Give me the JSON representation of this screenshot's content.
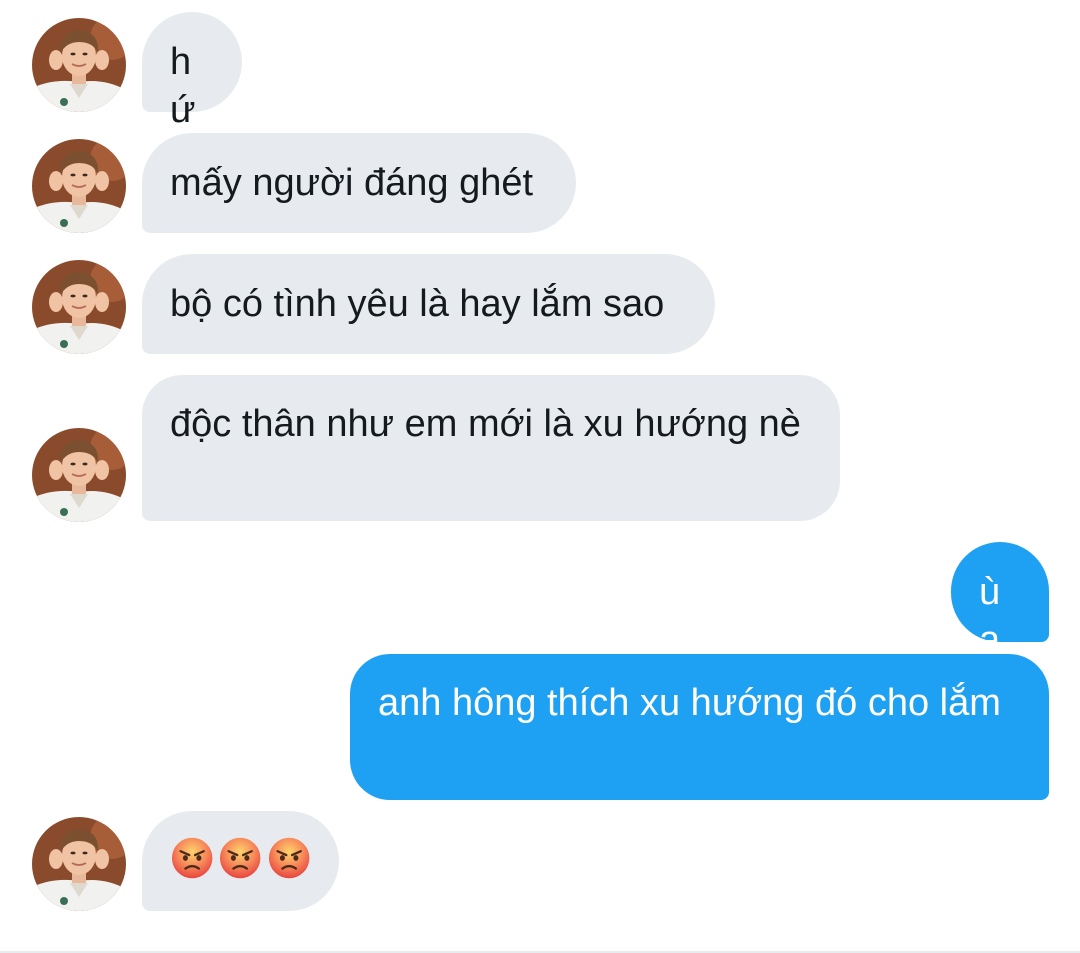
{
  "messages": [
    {
      "sender": "them",
      "text": "hứ"
    },
    {
      "sender": "them",
      "text": "mấy người đáng ghét"
    },
    {
      "sender": "them",
      "text": "bộ có tình yêu là hay lắm sao"
    },
    {
      "sender": "them",
      "text": "độc thân như em mới là xu hướng nè"
    },
    {
      "sender": "me",
      "text": "ùa"
    },
    {
      "sender": "me",
      "text": "anh hông thích xu hướng đó cho lắm"
    },
    {
      "sender": "them",
      "emojis": [
        "angry-face-icon",
        "angry-face-icon",
        "angry-face-icon"
      ]
    }
  ],
  "colors": {
    "incoming_bubble": "#e7ebef",
    "outgoing_bubble": "#1ea1f2",
    "incoming_text": "#151a1f",
    "outgoing_text": "#ffffff",
    "emoji_face": "#ef5a4f"
  },
  "avatar": {
    "icon": "contact-avatar-photo"
  }
}
